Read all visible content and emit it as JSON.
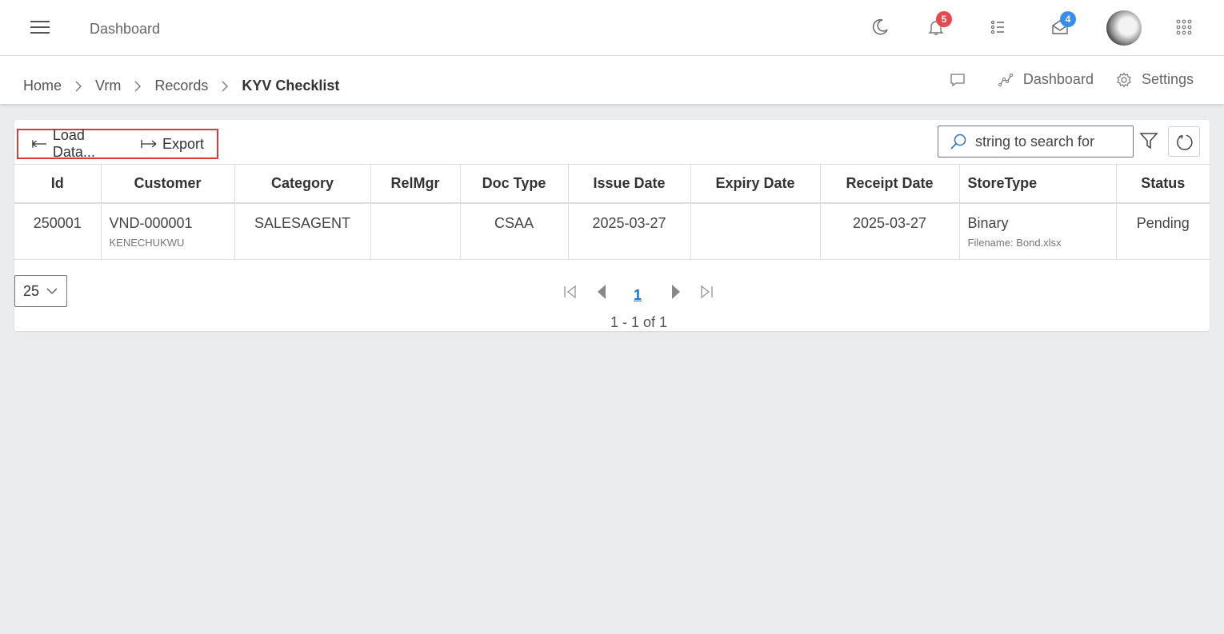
{
  "header": {
    "title": "Dashboard",
    "notifications_badge": "5",
    "messages_badge": "4",
    "icons": [
      "menu-icon",
      "moon-icon",
      "bell-icon",
      "list-icon",
      "mail-icon",
      "avatar",
      "apps-grid-icon"
    ]
  },
  "breadcrumb": {
    "items": [
      "Home",
      "Vrm",
      "Records"
    ],
    "current": "KYV Checklist",
    "actions": {
      "dashboard_label": "Dashboard",
      "settings_label": "Settings"
    }
  },
  "toolbar": {
    "load_label": "Load Data...",
    "export_label": "Export",
    "search_placeholder": "string to search for"
  },
  "table": {
    "columns": [
      "Id",
      "Customer",
      "Category",
      "RelMgr",
      "Doc Type",
      "Issue Date",
      "Expiry Date",
      "Receipt Date",
      "StoreType",
      "Status"
    ],
    "rows": [
      {
        "id": "250001",
        "customer": "VND-000001",
        "customer_sub": "KENECHUKWU",
        "category": "SALESAGENT",
        "relmgr": "",
        "doc_type": "CSAA",
        "issue_date": "2025-03-27",
        "expiry_date": "",
        "receipt_date": "2025-03-27",
        "store_type": "Binary",
        "store_type_sub": "Filename: Bond.xlsx",
        "status": "Pending"
      }
    ]
  },
  "pager": {
    "page_size": "25",
    "current_page": "1",
    "info": "1 - 1 of 1"
  },
  "colors": {
    "accent": "#1a6fd6",
    "highlight_border": "#d93a3a",
    "badge_red": "#e5484d",
    "badge_blue": "#3b8ee8"
  }
}
